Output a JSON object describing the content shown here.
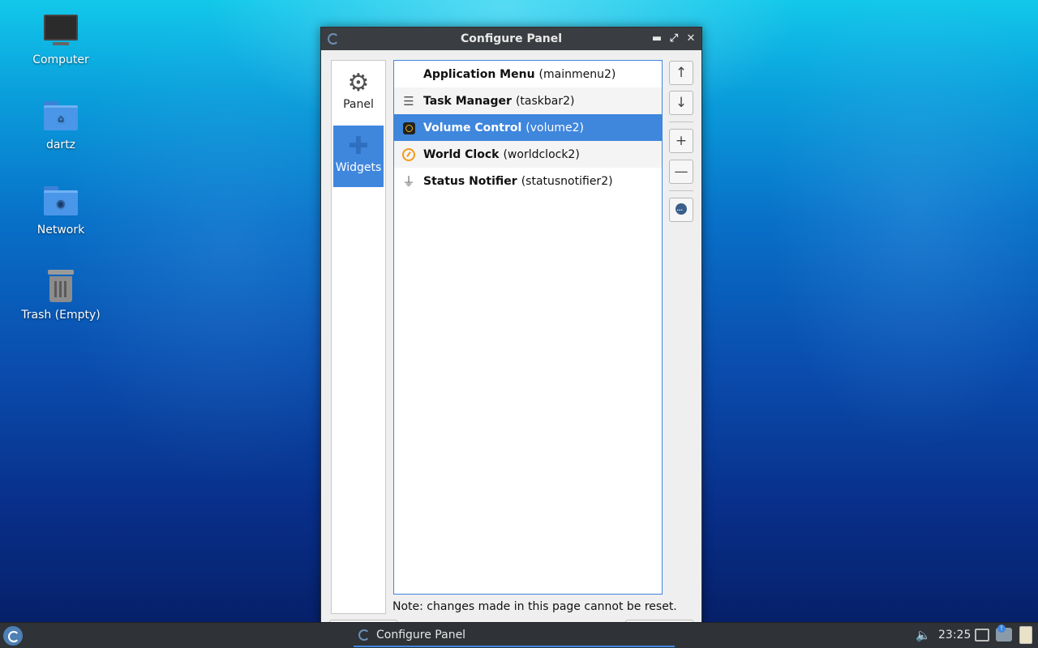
{
  "desktop": {
    "icons": [
      {
        "label": "Computer"
      },
      {
        "label": "dartz"
      },
      {
        "label": "Network"
      },
      {
        "label": "Trash (Empty)"
      }
    ]
  },
  "dialog": {
    "title": "Configure Panel",
    "sidebar": [
      {
        "label": "Panel",
        "icon": "gear-icon",
        "selected": false
      },
      {
        "label": "Widgets",
        "icon": "puzzle-icon",
        "selected": true
      }
    ],
    "widgets": [
      {
        "name": "Application Menu",
        "id": "(mainmenu2)",
        "icon": "none",
        "selected": false
      },
      {
        "name": "Task Manager",
        "id": "(taskbar2)",
        "icon": "taskbar-icon",
        "selected": false
      },
      {
        "name": "Volume Control",
        "id": "(volume2)",
        "icon": "volume-icon",
        "selected": true
      },
      {
        "name": "World Clock",
        "id": "(worldclock2)",
        "icon": "clock-icon",
        "selected": false
      },
      {
        "name": "Status Notifier",
        "id": "(statusnotifier2)",
        "icon": "usb-icon",
        "selected": false
      }
    ],
    "note": "Note: changes made in this page cannot be reset.",
    "buttons": {
      "move_up": "↑",
      "move_down": "↓",
      "add": "+",
      "remove": "—"
    }
  },
  "taskbar": {
    "task_label": "Configure Panel",
    "clock": "23:25"
  },
  "colors": {
    "selection": "#3f86dd",
    "titlebar": "#3a3d41",
    "taskbar": "#2f3236"
  }
}
